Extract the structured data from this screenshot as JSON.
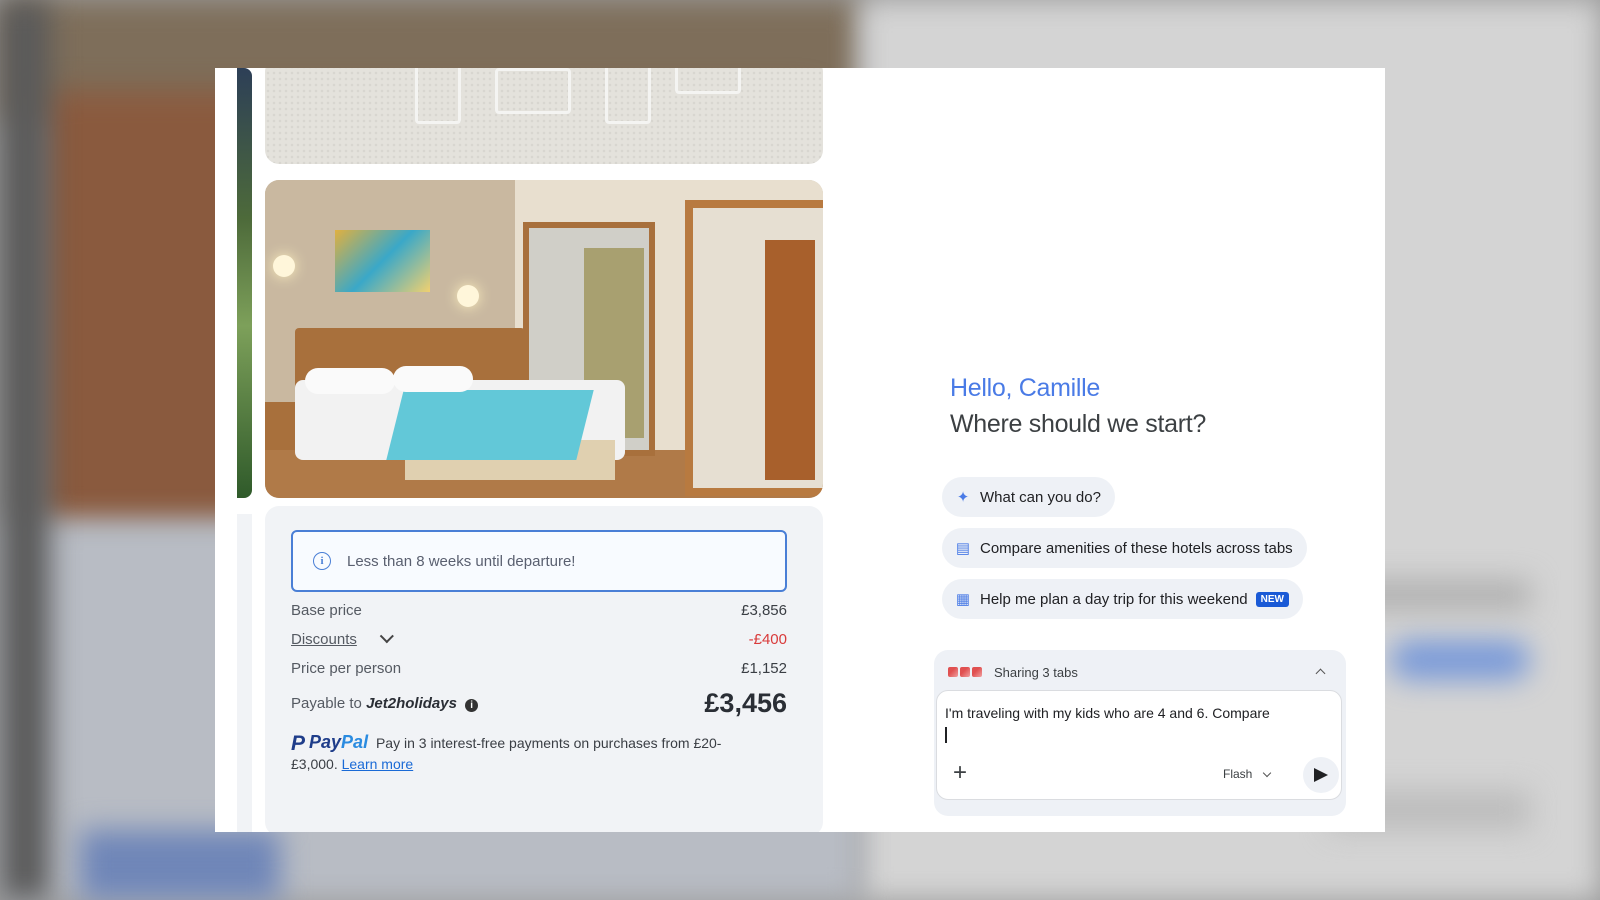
{
  "alert": {
    "text": "Less than 8 weeks until departure!"
  },
  "pricing": {
    "base_price_label": "Base price",
    "base_price_value": "£3,856",
    "discounts_label": "Discounts",
    "discounts_value": "-£400",
    "per_person_label": "Price per person",
    "per_person_value": "£1,152",
    "payable_label": "Payable to",
    "payable_brand": "Jet2holidays",
    "total": "£3,456"
  },
  "paypal": {
    "logo_pay": "Pay",
    "logo_pal": "Pal",
    "text": "Pay in 3 interest-free payments on purchases from £20-£3,000.",
    "learn_more": "Learn more"
  },
  "assistant": {
    "greeting": "Hello, Camille",
    "question": "Where should we start?",
    "suggestions": [
      {
        "icon": "sparkle-icon",
        "label": "What can you do?"
      },
      {
        "icon": "compare-icon",
        "label": "Compare amenities of these hotels across tabs"
      },
      {
        "icon": "plan-icon",
        "label": "Help me plan a day trip for this weekend",
        "badge": "NEW"
      }
    ],
    "sharing_label": "Sharing 3 tabs",
    "input_value": "I'm traveling with my kids who are 4 and 6. Compare",
    "model": "Flash"
  },
  "colors": {
    "accent": "#4a7be6",
    "alert_border": "#4a7fd6",
    "discount": "#d93a3a",
    "badge": "#1a5ad6"
  }
}
